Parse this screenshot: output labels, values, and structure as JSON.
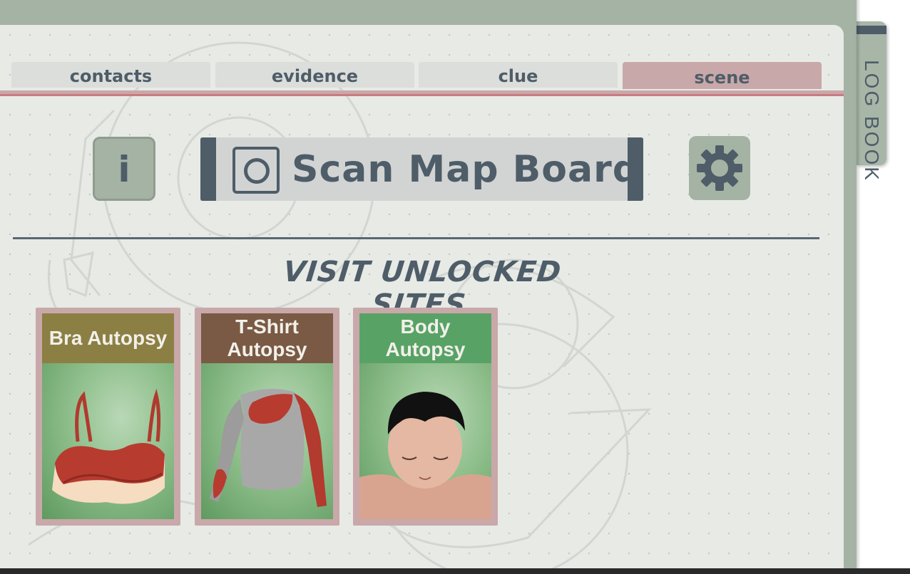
{
  "logbook": {
    "label": "LOG BOOK"
  },
  "tabs": [
    {
      "label": "contacts",
      "active": false
    },
    {
      "label": "evidence",
      "active": false
    },
    {
      "label": "clue",
      "active": false
    },
    {
      "label": "scene",
      "active": true
    }
  ],
  "toolbar": {
    "info_label": "i",
    "scan_label": "Scan Map Board",
    "settings_icon": "gear-icon",
    "scan_icon": "camera-icon"
  },
  "section": {
    "heading": "VISIT UNLOCKED SITES"
  },
  "sites": [
    {
      "label": "Bra Autopsy",
      "color": "#8c7f43",
      "image": "bra"
    },
    {
      "label": "T-Shirt Autopsy",
      "color": "#7a5a44",
      "image": "tshirt"
    },
    {
      "label": "Body Autopsy",
      "color": "#58a266",
      "image": "body"
    }
  ],
  "colors": {
    "accent_dark": "#4e5d68",
    "tab_active": "#c9a8aa",
    "button_green": "#a5b3a5",
    "panel": "#e8eae6"
  }
}
